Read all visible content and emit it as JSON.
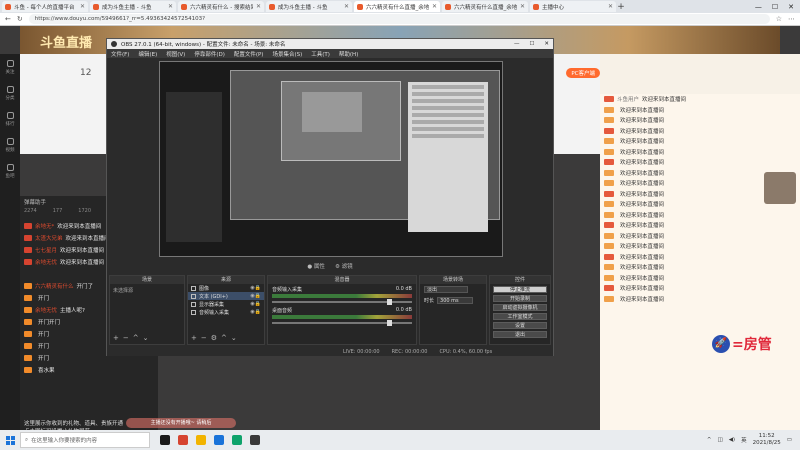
{
  "browser": {
    "tabs": [
      {
        "label": "斗鱼 - 每个人的直播平台",
        "active": false
      },
      {
        "label": "成为斗鱼主播 - 斗鱼",
        "active": false
      },
      {
        "label": "六六精灵有什么 - 搜索结果 - 斗鱼",
        "active": false
      },
      {
        "label": "成为斗鱼主播 - 斗鱼",
        "active": false
      },
      {
        "label": "六六精灵有什么直播_余地无...",
        "active": true
      },
      {
        "label": "六六精灵有什么直播_余地无...",
        "active": false
      },
      {
        "label": "主播中心",
        "active": false
      }
    ],
    "url": "https://www.douyu.com/5949661?_rr=5.4936342457254103?",
    "window_controls": [
      "—",
      "☐",
      "✕"
    ]
  },
  "page": {
    "site_title": "斗鱼直播",
    "room_number": "12",
    "pc_button": "PC客户端",
    "left_nav": [
      "关注",
      "分类",
      "排行",
      "视频",
      "鱼吧"
    ],
    "chat": {
      "header": "弹幕助手",
      "stats": [
        "2274",
        "177",
        "1720"
      ],
      "rows": [
        {
          "user": "余地无*",
          "text": "欢迎来到本直播间",
          "badge": "red"
        },
        {
          "user": "太渣大兄弟",
          "text": "欢迎来到本直播间",
          "badge": "red"
        },
        {
          "user": "七七星月",
          "text": "欢迎来到本直播间",
          "badge": "red"
        },
        {
          "user": "余地无忧",
          "text": "欢迎来到本直播间",
          "badge": "red"
        },
        {
          "user": "",
          "text": "",
          "badge": "none"
        },
        {
          "user": "六六精灵有什么",
          "text": "开门了",
          "badge": "orange"
        },
        {
          "user": "",
          "text": "开门",
          "badge": "orange"
        },
        {
          "user": "余地无忧",
          "text": "主播人呢?",
          "badge": "orange"
        },
        {
          "user": "",
          "text": "开门开门",
          "badge": "orange"
        },
        {
          "user": "",
          "text": "开门",
          "badge": "orange"
        },
        {
          "user": "",
          "text": "开门",
          "badge": "orange"
        },
        {
          "user": "",
          "text": "开门",
          "badge": "orange"
        },
        {
          "user": "",
          "text": "喜水果",
          "badge": "orange"
        }
      ],
      "footer": "这里展示你收到的礼物、道具、贵族开通\n点击图标可设置小礼物屏蔽"
    },
    "right_panel": {
      "rows": [
        {
          "name": "斗鱼用户",
          "text": "欢迎来到本直播间"
        },
        {
          "name": "",
          "text": "欢迎来到本直播间"
        },
        {
          "name": "",
          "text": "欢迎来到本直播间"
        },
        {
          "name": "",
          "text": "欢迎来到本直播间"
        },
        {
          "name": "",
          "text": "欢迎来到本直播间"
        },
        {
          "name": "",
          "text": "欢迎来到本直播间"
        },
        {
          "name": "",
          "text": "欢迎来到本直播间"
        },
        {
          "name": "",
          "text": "欢迎来到本直播间"
        },
        {
          "name": "",
          "text": "欢迎来到本直播间"
        },
        {
          "name": "",
          "text": "欢迎来到本直播间"
        },
        {
          "name": "",
          "text": "欢迎来到本直播间"
        },
        {
          "name": "",
          "text": "欢迎来到本直播间"
        },
        {
          "name": "",
          "text": "欢迎来到本直播间"
        },
        {
          "name": "",
          "text": "欢迎来到本直播间"
        },
        {
          "name": "",
          "text": "欢迎来到本直播间"
        },
        {
          "name": "",
          "text": "欢迎来到本直播间"
        },
        {
          "name": "",
          "text": "欢迎来到本直播间"
        },
        {
          "name": "",
          "text": "欢迎来到本直播间"
        },
        {
          "name": "",
          "text": "欢迎来到本直播间"
        },
        {
          "name": "",
          "text": "欢迎来到本直播间"
        }
      ],
      "fangguan": "=房管"
    },
    "toast": "主播还没有开播哦~ 请稍后"
  },
  "obs": {
    "title": "OBS 27.0.1 (64-bit, windows) - 配置文件: 未命名 - 场景: 未命名",
    "menu": [
      "文件(F)",
      "编辑(E)",
      "视图(V)",
      "停靠部件(D)",
      "配置文件(P)",
      "场景集合(S)",
      "工具(T)",
      "帮助(H)"
    ],
    "preview_bar": [
      "● 属性",
      "⚙ 滤镜"
    ],
    "docks": {
      "scenes": {
        "header": "场景",
        "label": "未选择源"
      },
      "sources": {
        "header": "来源",
        "items": [
          {
            "name": "图像",
            "selected": false
          },
          {
            "name": "文本 (GDI+)",
            "selected": true
          },
          {
            "name": "显示器采集",
            "selected": false
          },
          {
            "name": "音频输入采集",
            "selected": false
          }
        ]
      },
      "mixer": {
        "header": "混音器",
        "channels": [
          {
            "name": "音频输入采集",
            "db": "0.0 dB"
          },
          {
            "name": "桌面音频",
            "db": "0.0 dB"
          }
        ]
      },
      "transitions": {
        "header": "场景转场",
        "type": "淡出",
        "duration_label": "时长",
        "duration": "300 ms"
      },
      "controls": {
        "header": "控件",
        "buttons": [
          "停止推流",
          "开始录制",
          "启动虚拟摄像机",
          "工作室模式",
          "设置",
          "退出"
        ]
      }
    },
    "status": [
      "LIVE: 00:00:00",
      "REC: 00:00:00",
      "CPU: 0.4%, 60.00 fps"
    ]
  },
  "taskbar": {
    "search_placeholder": "在这里输入你要搜索的内容",
    "apps": [
      "#1a1a1a",
      "#d64430",
      "#f2b400",
      "#1a73d9",
      "#0fa36b",
      "#3a3a3a"
    ],
    "time": "11:52",
    "date": "2021/8/25",
    "ime": "英"
  }
}
